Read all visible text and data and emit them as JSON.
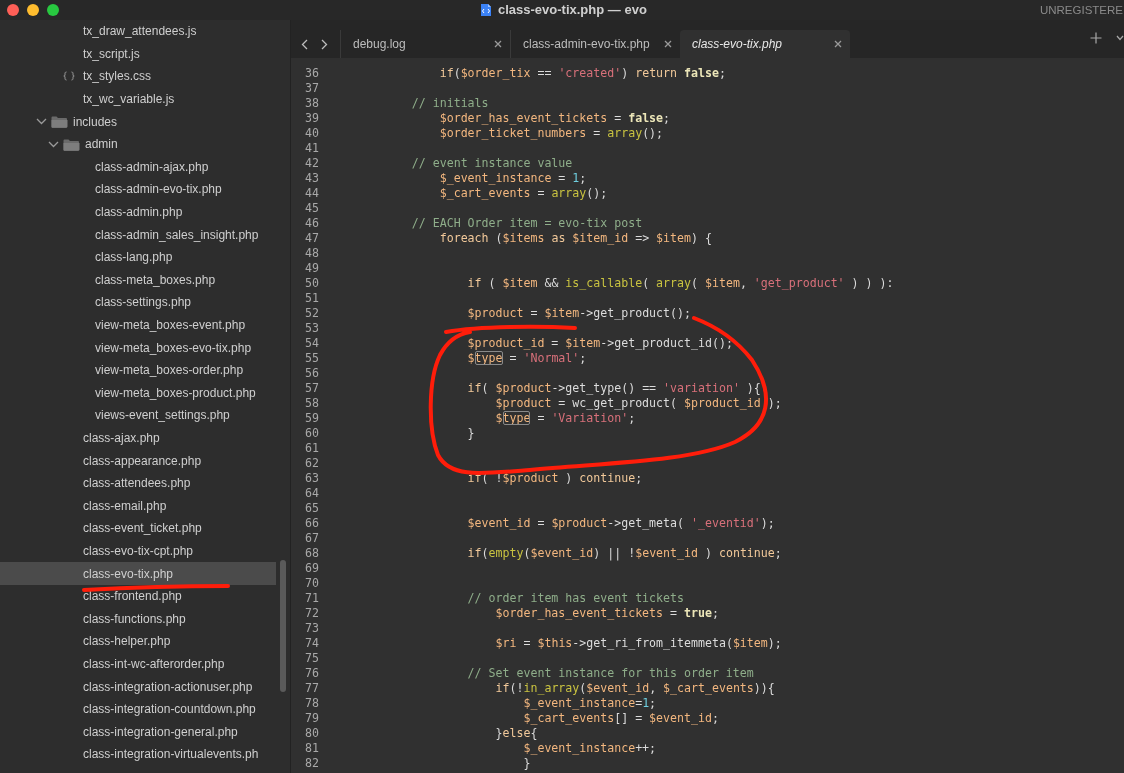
{
  "window": {
    "title": "class-evo-tix.php — evo",
    "license_notice": "UNREGISTERE"
  },
  "sidebar": {
    "items": [
      {
        "children": [
          {
            "label": "tx_draw_attendees.js",
            "kind": "file",
            "selected": false
          },
          {
            "label": "tx_script.js",
            "kind": "file",
            "selected": false
          },
          {
            "label": "tx_styles.css",
            "kind": "css",
            "selected": false
          },
          {
            "label": "tx_wc_variable.js",
            "kind": "file",
            "selected": false
          }
        ]
      },
      {
        "label": "includes",
        "kind": "folder",
        "expanded": true,
        "selected": false,
        "children": [
          {
            "label": "admin",
            "kind": "folder",
            "expanded": true,
            "selected": false,
            "children": [
              {
                "label": "class-admin-ajax.php",
                "kind": "file",
                "selected": false
              },
              {
                "label": "class-admin-evo-tix.php",
                "kind": "file",
                "selected": false
              },
              {
                "label": "class-admin.php",
                "kind": "file",
                "selected": false
              },
              {
                "label": "class-admin_sales_insight.php",
                "kind": "file",
                "selected": false
              },
              {
                "label": "class-lang.php",
                "kind": "file",
                "selected": false
              },
              {
                "label": "class-meta_boxes.php",
                "kind": "file",
                "selected": false
              },
              {
                "label": "class-settings.php",
                "kind": "file",
                "selected": false
              },
              {
                "label": "view-meta_boxes-event.php",
                "kind": "file",
                "selected": false
              },
              {
                "label": "view-meta_boxes-evo-tix.php",
                "kind": "file",
                "selected": false
              },
              {
                "label": "view-meta_boxes-order.php",
                "kind": "file",
                "selected": false
              },
              {
                "label": "view-meta_boxes-product.php",
                "kind": "file",
                "selected": false
              },
              {
                "label": "views-event_settings.php",
                "kind": "file",
                "selected": false
              }
            ]
          },
          {
            "label": "class-ajax.php",
            "kind": "file",
            "selected": false
          },
          {
            "label": "class-appearance.php",
            "kind": "file",
            "selected": false
          },
          {
            "label": "class-attendees.php",
            "kind": "file",
            "selected": false
          },
          {
            "label": "class-email.php",
            "kind": "file",
            "selected": false
          },
          {
            "label": "class-event_ticket.php",
            "kind": "file",
            "selected": false
          },
          {
            "label": "class-evo-tix-cpt.php",
            "kind": "file",
            "selected": false
          },
          {
            "label": "class-evo-tix.php",
            "kind": "file",
            "selected": true
          },
          {
            "label": "class-frontend.php",
            "kind": "file",
            "selected": false
          },
          {
            "label": "class-functions.php",
            "kind": "file",
            "selected": false
          },
          {
            "label": "class-helper.php",
            "kind": "file",
            "selected": false
          },
          {
            "label": "class-int-wc-afterorder.php",
            "kind": "file",
            "selected": false
          },
          {
            "label": "class-integration-actionuser.php",
            "kind": "file",
            "selected": false
          },
          {
            "label": "class-integration-countdown.php",
            "kind": "file",
            "selected": false
          },
          {
            "label": "class-integration-general.php",
            "kind": "file",
            "selected": false
          },
          {
            "label": "class-integration-virtualevents.ph",
            "kind": "file",
            "selected": false
          }
        ]
      }
    ]
  },
  "tabs": [
    {
      "label": "debug.log",
      "selected": false
    },
    {
      "label": "class-admin-evo-tix.php",
      "selected": false
    },
    {
      "label": "class-evo-tix.php",
      "selected": true
    }
  ],
  "editor": {
    "lines": [
      {
        "number": "36",
        "tokens": [
          {
            "kind": "keyword",
            "text": "\t\t\t\tif"
          },
          {
            "kind": "plain",
            "text": "("
          },
          {
            "kind": "variable",
            "text": "$order_tix"
          },
          {
            "kind": "plain",
            "text": " == "
          },
          {
            "kind": "string",
            "text": "'created'"
          },
          {
            "kind": "plain",
            "text": ") "
          },
          {
            "kind": "keyword",
            "text": "return "
          },
          {
            "kind": "literal",
            "text": "false"
          },
          {
            "kind": "plain",
            "text": ";"
          }
        ]
      },
      {
        "number": "37"
      },
      {
        "number": "38",
        "tokens": [
          {
            "kind": "comment",
            "text": "\t\t\t// initials"
          }
        ]
      },
      {
        "number": "39",
        "tokens": [
          {
            "kind": "variable",
            "text": "\t\t\t\t$order_has_event_tickets"
          },
          {
            "kind": "plain",
            "text": " = "
          },
          {
            "kind": "literal",
            "text": "false"
          },
          {
            "kind": "plain",
            "text": ";"
          }
        ]
      },
      {
        "number": "40",
        "tokens": [
          {
            "kind": "variable",
            "text": "\t\t\t\t$order_ticket_numbers"
          },
          {
            "kind": "plain",
            "text": " = "
          },
          {
            "kind": "function",
            "text": "array"
          },
          {
            "kind": "plain",
            "text": "();"
          }
        ]
      },
      {
        "number": "41"
      },
      {
        "number": "42",
        "tokens": [
          {
            "kind": "comment",
            "text": "\t\t\t// event instance value"
          }
        ]
      },
      {
        "number": "43",
        "tokens": [
          {
            "kind": "variable",
            "text": "\t\t\t\t$_event_instance"
          },
          {
            "kind": "plain",
            "text": " = "
          },
          {
            "kind": "number",
            "text": "1"
          },
          {
            "kind": "plain",
            "text": ";"
          }
        ]
      },
      {
        "number": "44",
        "tokens": [
          {
            "kind": "variable",
            "text": "\t\t\t\t$_cart_events"
          },
          {
            "kind": "plain",
            "text": " = "
          },
          {
            "kind": "function",
            "text": "array"
          },
          {
            "kind": "plain",
            "text": "();"
          }
        ]
      },
      {
        "number": "45"
      },
      {
        "number": "46",
        "tokens": [
          {
            "kind": "comment",
            "text": "\t\t\t// EACH Order item = evo-tix post"
          }
        ]
      },
      {
        "number": "47",
        "tokens": [
          {
            "kind": "keyword",
            "text": "\t\t\t\tforeach"
          },
          {
            "kind": "plain",
            "text": " ("
          },
          {
            "kind": "variable",
            "text": "$items"
          },
          {
            "kind": "keyword",
            "text": " as "
          },
          {
            "kind": "variable",
            "text": "$item_id"
          },
          {
            "kind": "plain",
            "text": " => "
          },
          {
            "kind": "variable",
            "text": "$item"
          },
          {
            "kind": "plain",
            "text": ") {"
          }
        ]
      },
      {
        "number": "48"
      },
      {
        "number": "49"
      },
      {
        "number": "50",
        "tokens": [
          {
            "kind": "keyword",
            "text": "\t\t\t\t\tif"
          },
          {
            "kind": "plain",
            "text": " ( "
          },
          {
            "kind": "variable",
            "text": "$item"
          },
          {
            "kind": "plain",
            "text": " && "
          },
          {
            "kind": "function",
            "text": "is_callable"
          },
          {
            "kind": "plain",
            "text": "( "
          },
          {
            "kind": "function",
            "text": "array"
          },
          {
            "kind": "plain",
            "text": "( "
          },
          {
            "kind": "variable",
            "text": "$item"
          },
          {
            "kind": "plain",
            "text": ", "
          },
          {
            "kind": "string",
            "text": "'get_product'"
          },
          {
            "kind": "plain",
            "text": " ) ) ):"
          }
        ]
      },
      {
        "number": "51"
      },
      {
        "number": "52",
        "tokens": [
          {
            "kind": "variable",
            "text": "\t\t\t\t\t$product"
          },
          {
            "kind": "plain",
            "text": " = "
          },
          {
            "kind": "variable",
            "text": "$item"
          },
          {
            "kind": "plain",
            "text": "->get_product();"
          }
        ]
      },
      {
        "number": "53"
      },
      {
        "number": "54",
        "tokens": [
          {
            "kind": "variable",
            "text": "\t\t\t\t\t$product_id"
          },
          {
            "kind": "plain",
            "text": " = "
          },
          {
            "kind": "variable",
            "text": "$item"
          },
          {
            "kind": "plain",
            "text": "->get_product_id();"
          }
        ]
      },
      {
        "number": "55",
        "tokens": [
          {
            "kind": "variable",
            "text": "\t\t\t\t\t$"
          },
          {
            "kind": "match",
            "text": "type"
          },
          {
            "kind": "plain",
            "text": " = "
          },
          {
            "kind": "string",
            "text": "'Normal'"
          },
          {
            "kind": "plain",
            "text": ";"
          }
        ]
      },
      {
        "number": "56"
      },
      {
        "number": "57",
        "tokens": [
          {
            "kind": "keyword",
            "text": "\t\t\t\t\tif"
          },
          {
            "kind": "plain",
            "text": "( "
          },
          {
            "kind": "variable",
            "text": "$product"
          },
          {
            "kind": "plain",
            "text": "->get_type() == "
          },
          {
            "kind": "string",
            "text": "'variation'"
          },
          {
            "kind": "plain",
            "text": " ){"
          }
        ]
      },
      {
        "number": "58",
        "tokens": [
          {
            "kind": "variable",
            "text": "\t\t\t\t\t\t$product"
          },
          {
            "kind": "plain",
            "text": " = wc_get_product( "
          },
          {
            "kind": "variable",
            "text": "$product_id"
          },
          {
            "kind": "plain",
            "text": " );"
          }
        ]
      },
      {
        "number": "59",
        "tokens": [
          {
            "kind": "variable",
            "text": "\t\t\t\t\t\t$"
          },
          {
            "kind": "match",
            "text": "type"
          },
          {
            "kind": "plain",
            "text": " = "
          },
          {
            "kind": "string",
            "text": "'Variation'"
          },
          {
            "kind": "plain",
            "text": ";"
          }
        ]
      },
      {
        "number": "60",
        "tokens": [
          {
            "kind": "plain",
            "text": "\t\t\t\t\t}"
          }
        ]
      },
      {
        "number": "61"
      },
      {
        "number": "62"
      },
      {
        "number": "63",
        "tokens": [
          {
            "kind": "keyword",
            "text": "\t\t\t\t\tif"
          },
          {
            "kind": "plain",
            "text": "( !"
          },
          {
            "kind": "variable",
            "text": "$product"
          },
          {
            "kind": "plain",
            "text": " ) "
          },
          {
            "kind": "keyword",
            "text": "continue"
          },
          {
            "kind": "plain",
            "text": ";"
          }
        ]
      },
      {
        "number": "64"
      },
      {
        "number": "65"
      },
      {
        "number": "66",
        "tokens": [
          {
            "kind": "variable",
            "text": "\t\t\t\t\t$event_id"
          },
          {
            "kind": "plain",
            "text": " = "
          },
          {
            "kind": "variable",
            "text": "$product"
          },
          {
            "kind": "plain",
            "text": "->get_meta( "
          },
          {
            "kind": "string",
            "text": "'_eventid'"
          },
          {
            "kind": "plain",
            "text": ");"
          }
        ]
      },
      {
        "number": "67"
      },
      {
        "number": "68",
        "tokens": [
          {
            "kind": "keyword",
            "text": "\t\t\t\t\tif"
          },
          {
            "kind": "plain",
            "text": "("
          },
          {
            "kind": "function",
            "text": "empty"
          },
          {
            "kind": "plain",
            "text": "("
          },
          {
            "kind": "variable",
            "text": "$event_id"
          },
          {
            "kind": "plain",
            "text": ") || !"
          },
          {
            "kind": "variable",
            "text": "$event_id"
          },
          {
            "kind": "plain",
            "text": " ) "
          },
          {
            "kind": "keyword",
            "text": "continue"
          },
          {
            "kind": "plain",
            "text": ";"
          }
        ]
      },
      {
        "number": "69"
      },
      {
        "number": "70"
      },
      {
        "number": "71",
        "tokens": [
          {
            "kind": "comment",
            "text": "\t\t\t\t\t// order item has event tickets"
          }
        ]
      },
      {
        "number": "72",
        "tokens": [
          {
            "kind": "variable",
            "text": "\t\t\t\t\t\t$order_has_event_tickets"
          },
          {
            "kind": "plain",
            "text": " = "
          },
          {
            "kind": "literal",
            "text": "true"
          },
          {
            "kind": "plain",
            "text": ";"
          }
        ]
      },
      {
        "number": "73"
      },
      {
        "number": "74",
        "tokens": [
          {
            "kind": "variable",
            "text": "\t\t\t\t\t\t$ri"
          },
          {
            "kind": "plain",
            "text": " = "
          },
          {
            "kind": "variable",
            "text": "$this"
          },
          {
            "kind": "plain",
            "text": "->get_ri_from_itemmeta("
          },
          {
            "kind": "variable",
            "text": "$item"
          },
          {
            "kind": "plain",
            "text": ");"
          }
        ]
      },
      {
        "number": "75"
      },
      {
        "number": "76",
        "tokens": [
          {
            "kind": "comment",
            "text": "\t\t\t\t\t// Set event instance for this order item"
          }
        ]
      },
      {
        "number": "77",
        "tokens": [
          {
            "kind": "keyword",
            "text": "\t\t\t\t\t\tif"
          },
          {
            "kind": "plain",
            "text": "(!"
          },
          {
            "kind": "function",
            "text": "in_array"
          },
          {
            "kind": "plain",
            "text": "("
          },
          {
            "kind": "variable",
            "text": "$event_id"
          },
          {
            "kind": "plain",
            "text": ", "
          },
          {
            "kind": "variable",
            "text": "$_cart_events"
          },
          {
            "kind": "plain",
            "text": ")){"
          }
        ]
      },
      {
        "number": "78",
        "tokens": [
          {
            "kind": "variable",
            "text": "\t\t\t\t\t\t\t$_event_instance"
          },
          {
            "kind": "plain",
            "text": "="
          },
          {
            "kind": "number",
            "text": "1"
          },
          {
            "kind": "plain",
            "text": ";"
          }
        ]
      },
      {
        "number": "79",
        "tokens": [
          {
            "kind": "variable",
            "text": "\t\t\t\t\t\t\t$_cart_events"
          },
          {
            "kind": "plain",
            "text": "[] = "
          },
          {
            "kind": "variable",
            "text": "$event_id"
          },
          {
            "kind": "plain",
            "text": ";"
          }
        ]
      },
      {
        "number": "80",
        "tokens": [
          {
            "kind": "plain",
            "text": "\t\t\t\t\t\t}"
          },
          {
            "kind": "keyword",
            "text": "else"
          },
          {
            "kind": "plain",
            "text": "{"
          }
        ]
      },
      {
        "number": "81",
        "tokens": [
          {
            "kind": "variable",
            "text": "\t\t\t\t\t\t\t$_event_instance"
          },
          {
            "kind": "plain",
            "text": "++;"
          }
        ]
      },
      {
        "number": "82",
        "tokens": [
          {
            "kind": "plain",
            "text": "\t\t\t\t\t\t\t}"
          }
        ]
      }
    ]
  }
}
